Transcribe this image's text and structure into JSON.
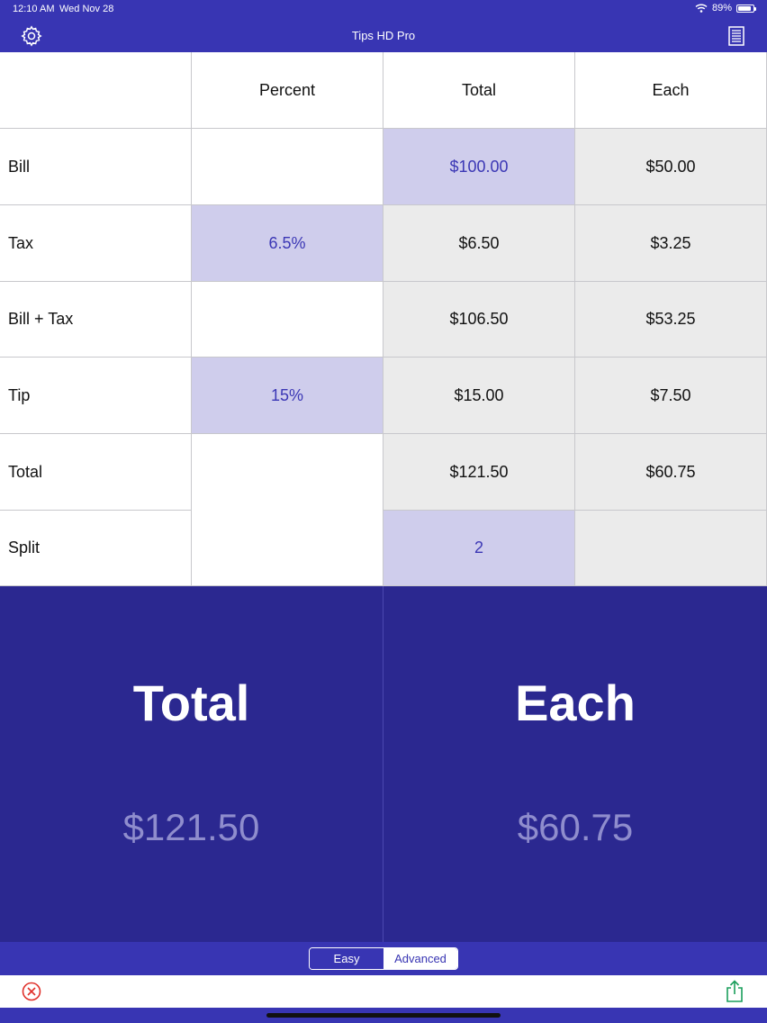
{
  "status": {
    "time": "12:10 AM",
    "date": "Wed Nov 28",
    "battery": "89%"
  },
  "nav": {
    "title": "Tips HD Pro"
  },
  "grid": {
    "headers": [
      "",
      "Percent",
      "Total",
      "Each"
    ],
    "rows": [
      {
        "label": "Bill",
        "percent": "",
        "total": "$100.00",
        "each": "$50.00"
      },
      {
        "label": "Tax",
        "percent": "6.5%",
        "total": "$6.50",
        "each": "$3.25"
      },
      {
        "label": "Bill + Tax",
        "percent": "",
        "total": "$106.50",
        "each": "$53.25"
      },
      {
        "label": "Tip",
        "percent": "15%",
        "total": "$15.00",
        "each": "$7.50"
      },
      {
        "label": "Total",
        "percent": "",
        "total": "$121.50",
        "each": "$60.75"
      },
      {
        "label": "Split",
        "percent": "",
        "total": "2",
        "each": ""
      }
    ]
  },
  "summary": {
    "total_title": "Total",
    "total_value": "$121.50",
    "each_title": "Each",
    "each_value": "$60.75"
  },
  "mode": {
    "easy": "Easy",
    "advanced": "Advanced",
    "selected": "Easy"
  },
  "colors": {
    "accent": "#3835b3",
    "panel": "#2b2890",
    "input_cell": "#cfcdec",
    "computed_cell": "#ebebeb",
    "cancel": "#e0302a",
    "share": "#1a9e5c"
  },
  "icons": {
    "settings": "gear-icon",
    "list": "list-icon",
    "cancel": "cancel-icon",
    "share": "share-icon"
  }
}
